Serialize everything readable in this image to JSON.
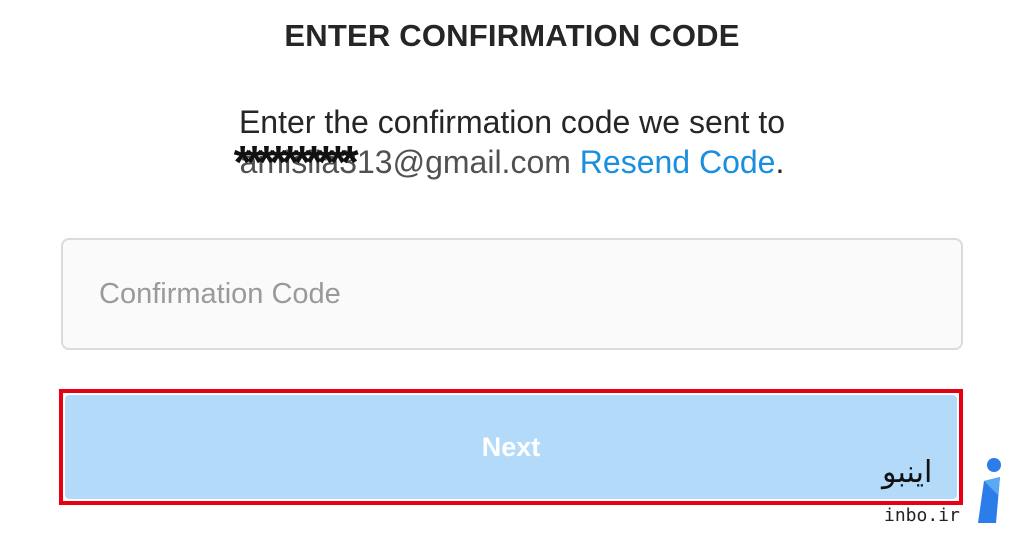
{
  "header": {
    "title": "ENTER CONFIRMATION CODE"
  },
  "message": {
    "line1": "Enter the confirmation code we sent to",
    "email": "amisila313@gmail.com",
    "email_mask": "**********",
    "resend_link": "Resend Code",
    "trailing": "."
  },
  "form": {
    "code_placeholder": "Confirmation Code",
    "code_value": "",
    "next_label": "Next"
  },
  "watermark": {
    "persian": "اینبو",
    "domain": "inbo.ir",
    "icon": "inbo-logo-icon"
  },
  "colors": {
    "link": "#1a8fe0",
    "button_bg": "#b3dbf9",
    "highlight_border": "#e60012",
    "input_bg": "#fafafa",
    "input_border": "#dbdbdb"
  }
}
